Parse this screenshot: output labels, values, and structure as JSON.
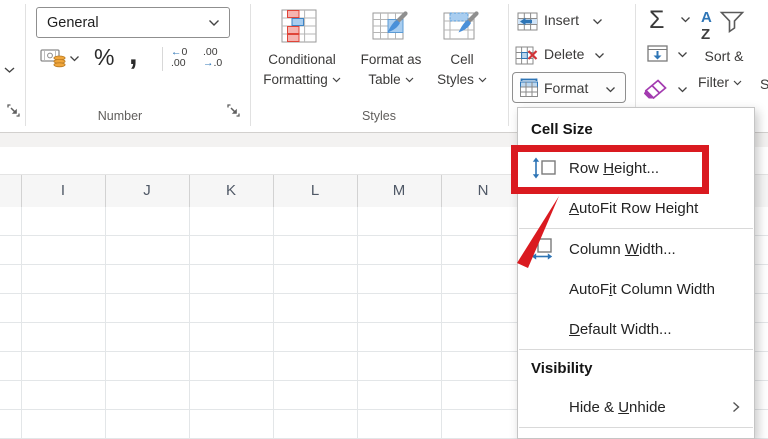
{
  "ribbon": {
    "number_group": {
      "label": "Number",
      "format_value": "General",
      "percent": "%",
      "comma": ",",
      "increase_decimal": {
        "arrow": "←",
        "top": "0",
        "bottom": ".00"
      },
      "decrease_decimal": {
        "top": ".00",
        "arrow": "→",
        "bottom": ".0"
      }
    },
    "styles_group": {
      "label": "Styles",
      "buttons": [
        {
          "name": "conditional-formatting",
          "line1": "Conditional",
          "line2": "Formatting"
        },
        {
          "name": "format-as-table",
          "line1": "Format as",
          "line2": "Table"
        },
        {
          "name": "cell-styles",
          "line1": "Cell",
          "line2": "Styles"
        }
      ]
    },
    "cells_group": {
      "insert": "Insert",
      "delete": "Delete",
      "format": "Format"
    },
    "editing_group": {
      "autosum": "Σ",
      "sort_line1": "Sort &",
      "sort_line2": "Filter",
      "partial_label": "S"
    }
  },
  "sheet": {
    "columns": [
      "I",
      "J",
      "K",
      "L",
      "M",
      "N"
    ]
  },
  "format_menu": {
    "sections": [
      {
        "header": "Cell Size",
        "items": [
          {
            "name": "row-height",
            "pre": "Row ",
            "accel": "H",
            "post": "eight...",
            "icon": "row-height",
            "annotated": true
          },
          {
            "name": "autofit-row-height",
            "pre": "",
            "accel": "A",
            "post": "utoFit Row Height",
            "divider_after": true
          },
          {
            "name": "column-width",
            "pre": "Column ",
            "accel": "W",
            "post": "idth...",
            "icon": "column-width"
          },
          {
            "name": "autofit-column-width",
            "pre": "AutoF",
            "accel": "i",
            "post": "t Column Width"
          },
          {
            "name": "default-width",
            "pre": "",
            "accel": "D",
            "post": "efault Width...",
            "divider_after": true
          }
        ]
      },
      {
        "header": "Visibility",
        "items": [
          {
            "name": "hide-unhide",
            "pre": "Hide & ",
            "accel": "U",
            "post": "nhide",
            "submenu": true,
            "divider_after": true
          }
        ]
      }
    ]
  },
  "colors": {
    "annotation_red": "#da1a20",
    "icon_blue": "#2e75b6",
    "icon_red": "#d13438",
    "icon_orange": "#f0a63c",
    "icon_purple": "#a33bb0"
  }
}
